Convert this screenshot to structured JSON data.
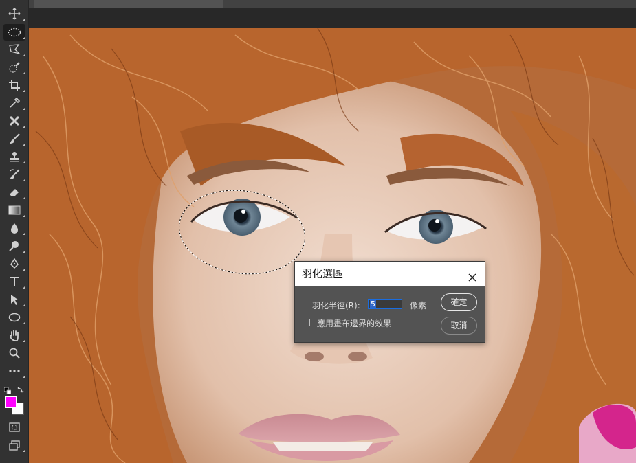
{
  "tools": [
    {
      "name": "move-tool"
    },
    {
      "name": "elliptical-marquee-tool",
      "active": true
    },
    {
      "name": "polygonal-lasso-tool"
    },
    {
      "name": "quick-selection-tool"
    },
    {
      "name": "crop-tool"
    },
    {
      "name": "eyedropper-tool"
    },
    {
      "name": "spot-healing-tool"
    },
    {
      "name": "brush-tool"
    },
    {
      "name": "clone-stamp-tool"
    },
    {
      "name": "history-brush-tool"
    },
    {
      "name": "eraser-tool"
    },
    {
      "name": "gradient-tool"
    },
    {
      "name": "blur-tool"
    },
    {
      "name": "dodge-tool"
    },
    {
      "name": "pen-tool"
    },
    {
      "name": "type-tool"
    },
    {
      "name": "path-selection-tool"
    },
    {
      "name": "ellipse-tool"
    },
    {
      "name": "hand-tool"
    },
    {
      "name": "zoom-tool"
    },
    {
      "name": "more-tools"
    }
  ],
  "colors": {
    "foreground": "#ff00ff",
    "background": "#ffffff"
  },
  "dialog": {
    "title": "羽化選區",
    "radius_label": "羽化半徑(R):",
    "radius_value": "5",
    "unit": "像素",
    "checkbox_label": "應用畫布邊界的效果",
    "checkbox_checked": false,
    "ok_label": "確定",
    "cancel_label": "取消"
  }
}
